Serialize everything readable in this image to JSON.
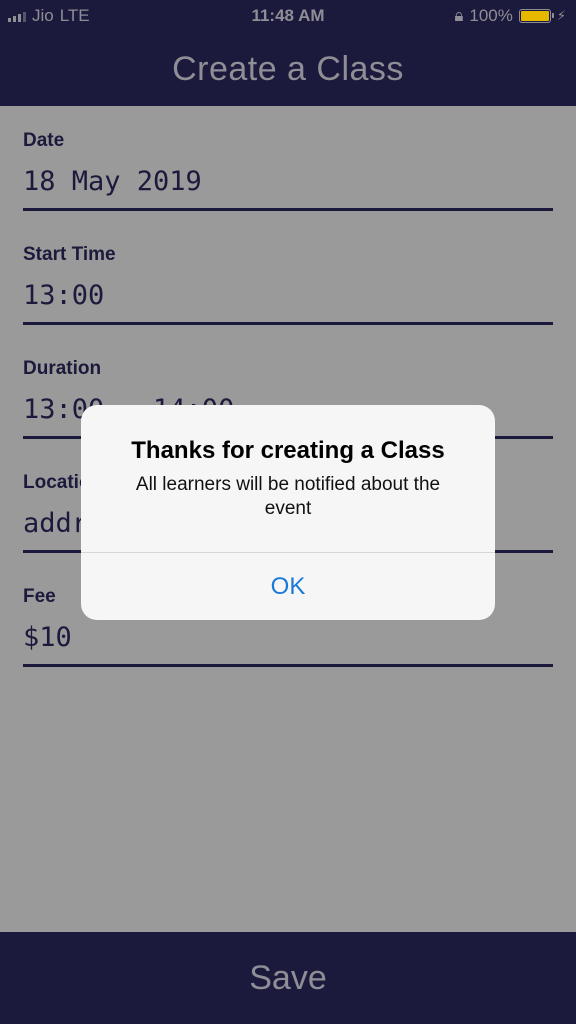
{
  "status_bar": {
    "carrier": "Jio",
    "network": "LTE",
    "time": "11:48 AM",
    "battery_percent": "100%",
    "battery_level": 1.0
  },
  "nav": {
    "title": "Create a Class"
  },
  "form": {
    "fields": [
      {
        "label": "Date",
        "value": "18 May 2019"
      },
      {
        "label": "Start Time",
        "value": "13:00"
      },
      {
        "label": "Duration",
        "value": "13:00 - 14:00"
      },
      {
        "label": "Location",
        "value": "address"
      },
      {
        "label": "Fee",
        "value": "$10"
      }
    ]
  },
  "footer": {
    "save_label": "Save"
  },
  "alert": {
    "title": "Thanks for creating a Class",
    "message": "All learners will be notified about the event",
    "ok_label": "OK"
  },
  "colors": {
    "bar_background": "#1c1a3c",
    "overlay_background": "#9a9a9a",
    "alert_button": "#1a78d6",
    "battery": "#e6b800"
  }
}
